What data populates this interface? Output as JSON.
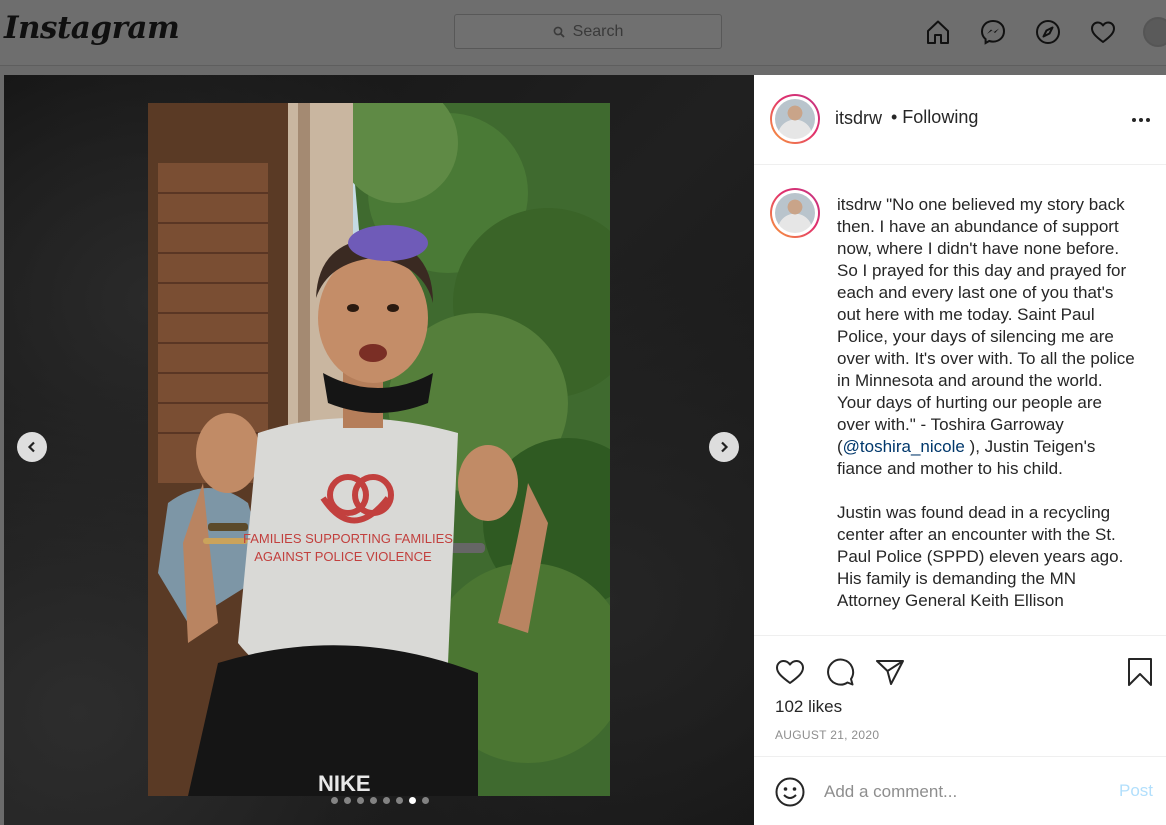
{
  "nav": {
    "logo": "Instagram",
    "search_placeholder": "Search"
  },
  "post": {
    "username": "itsdrw",
    "follow_status": "• Following",
    "caption_username": "itsdrw",
    "caption_part1": " \"No one believed my story back then. I have an abundance of support now, where I didn't have none before. So I prayed for this day and prayed for each and every last one of you that's out here with me today. Saint Paul Police, your days of silencing me are over with. It's over with. To all the police in Minnesota and around the world. Your days of hurting our people are over with.\" - Toshira Garroway (",
    "caption_mention": "@toshira_nicole",
    "caption_part2": " ), Justin Teigen's fiance and mother to his child.\n\nJustin was found dead in a recycling center after an encounter with the St. Paul Police (SPPD) eleven years ago. His family is demanding the MN Attorney General Keith Ellison",
    "likes": "102 likes",
    "date": "AUGUST 21, 2020",
    "comment_placeholder": "Add a comment...",
    "post_label": "Post",
    "carousel_count": 8,
    "carousel_active_index": 6,
    "photo_shirt_text_line1": "FAMILIES SUPPORTING FAMILIES",
    "photo_shirt_text_line2": "AGAINST POLICE VIOLENCE",
    "photo_brand_text": "NIKE"
  },
  "colors": {
    "mention": "#00376b",
    "post_button_disabled": "#b2dffc",
    "story_ring_start": "#f9a13a",
    "story_ring_end": "#c13584"
  },
  "icons": [
    "search-icon",
    "home-icon",
    "messenger-icon",
    "explore-icon",
    "heart-icon",
    "more-icon",
    "like-icon",
    "comment-icon",
    "share-icon",
    "bookmark-icon",
    "emoji-icon",
    "chevron-left-icon",
    "chevron-right-icon"
  ]
}
